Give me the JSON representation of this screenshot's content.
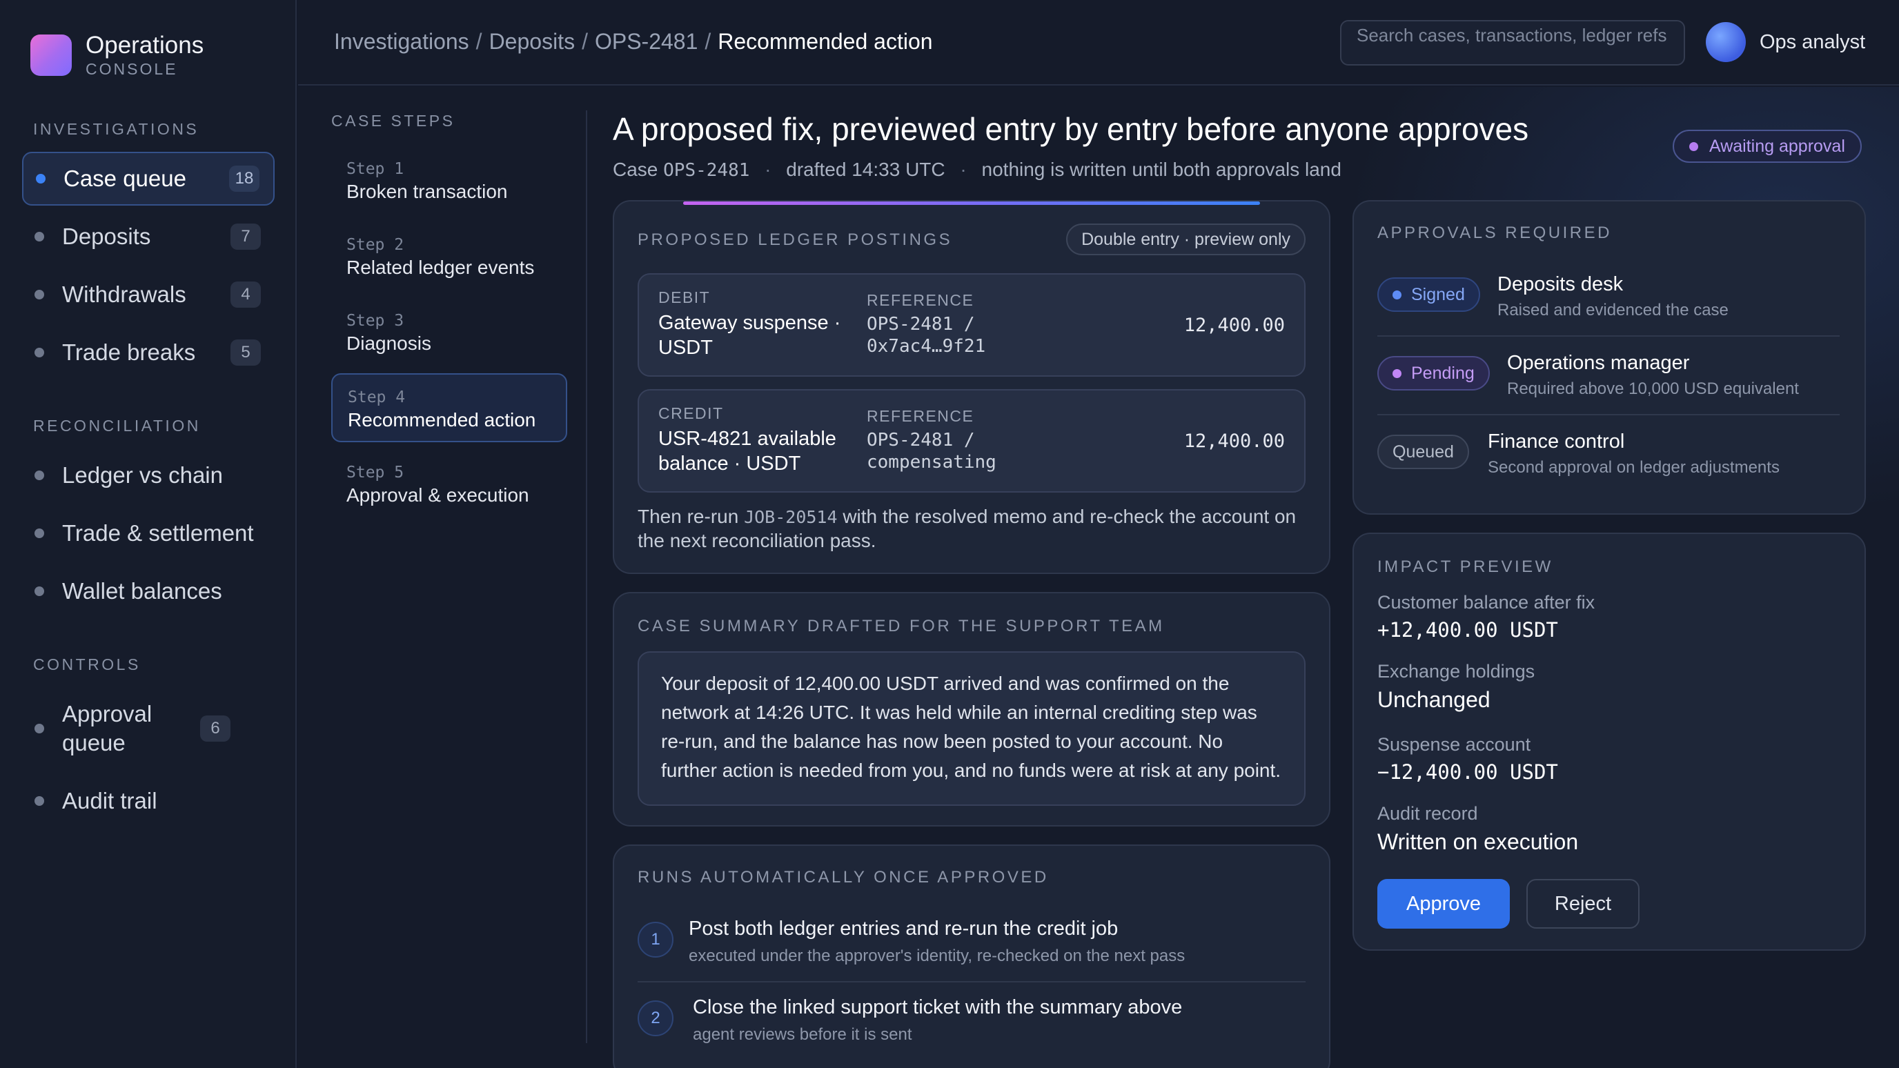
{
  "brand": {
    "title": "Operations",
    "subtitle": "CONSOLE"
  },
  "sidebar": {
    "sections": [
      {
        "label": "INVESTIGATIONS"
      },
      {
        "label": "RECONCILIATION"
      },
      {
        "label": "CONTROLS"
      }
    ],
    "items": [
      {
        "label": "Case queue",
        "badge": "18"
      },
      {
        "label": "Deposits",
        "badge": "7"
      },
      {
        "label": "Withdrawals",
        "badge": "4"
      },
      {
        "label": "Trade breaks",
        "badge": "5"
      },
      {
        "label": "Ledger vs chain"
      },
      {
        "label": "Trade & settlement"
      },
      {
        "label": "Wallet balances"
      },
      {
        "label": "Approval queue",
        "badge": "6"
      },
      {
        "label": "Audit trail"
      }
    ]
  },
  "header": {
    "breadcrumb": [
      "Investigations",
      "Deposits",
      "OPS-2481",
      "Recommended action"
    ],
    "search_placeholder": "Search cases, transactions, ledger refs",
    "user": "Ops analyst"
  },
  "steps": {
    "title": "CASE STEPS",
    "items": [
      {
        "num": "Step 1",
        "name": "Broken transaction"
      },
      {
        "num": "Step 2",
        "name": "Related ledger events"
      },
      {
        "num": "Step 3",
        "name": "Diagnosis"
      },
      {
        "num": "Step 4",
        "name": "Recommended action"
      },
      {
        "num": "Step 5",
        "name": "Approval & execution"
      }
    ]
  },
  "page": {
    "title": "A proposed fix, previewed entry by entry before anyone approves",
    "meta_case_prefix": "Case",
    "meta_case_id": "OPS-2481",
    "meta_drafted": "drafted 14:33 UTC",
    "meta_note": "nothing is written until both approvals land",
    "status": "Awaiting approval"
  },
  "postings": {
    "label": "PROPOSED LEDGER POSTINGS",
    "chip": "Double entry · preview only",
    "entries": [
      {
        "side": "DEBIT",
        "account": "Gateway suspense · USDT",
        "ref_label": "REFERENCE",
        "ref1": "OPS-2481 /",
        "ref2": "0x7ac4…9f21",
        "amount": "12,400.00"
      },
      {
        "side": "CREDIT",
        "account": "USR-4821 available balance · USDT",
        "ref_label": "REFERENCE",
        "ref1": "OPS-2481 /",
        "ref2": "compensating",
        "amount": "12,400.00"
      }
    ],
    "note_pre": "Then re-run",
    "note_job": "JOB-20514",
    "note_post": "with the resolved memo and re-check the account on the next reconciliation pass."
  },
  "summary": {
    "label": "CASE SUMMARY DRAFTED FOR THE SUPPORT TEAM",
    "text": "Your deposit of 12,400.00 USDT arrived and was confirmed on the network at 14:26 UTC. It was held while an internal crediting step was re-run, and the balance has now been posted to your account. No further action is needed from you, and no funds were at risk at any point."
  },
  "runs": {
    "label": "RUNS AUTOMATICALLY ONCE APPROVED",
    "items": [
      {
        "num": "1",
        "title": "Post both ledger entries and re-run the credit job",
        "sub": "executed under the approver's identity, re-checked on the next pass"
      },
      {
        "num": "2",
        "title": "Close the linked support ticket with the summary above",
        "sub": "agent reviews before it is sent"
      }
    ]
  },
  "approvals": {
    "label": "APPROVALS REQUIRED",
    "items": [
      {
        "status": "Signed",
        "name": "Deposits desk",
        "desc": "Raised and evidenced the case"
      },
      {
        "status": "Pending",
        "name": "Operations manager",
        "desc": "Required above 10,000 USD equivalent"
      },
      {
        "status": "Queued",
        "name": "Finance control",
        "desc": "Second approval on ledger adjustments"
      }
    ]
  },
  "impact": {
    "label": "IMPACT PREVIEW",
    "rows": [
      {
        "label": "Customer balance after fix",
        "value": "+12,400.00 USDT"
      },
      {
        "label": "Exchange holdings",
        "value": "Unchanged"
      },
      {
        "label": "Suspense account",
        "value": "−12,400.00 USDT"
      },
      {
        "label": "Audit record",
        "value": "Written on execution"
      }
    ],
    "approve": "Approve",
    "reject": "Reject"
  },
  "colors": {
    "accent": "#2f6fe8",
    "active_nav_bg": "#1f2a44",
    "pending": "#c186f5",
    "signed": "#5e8cf6"
  }
}
